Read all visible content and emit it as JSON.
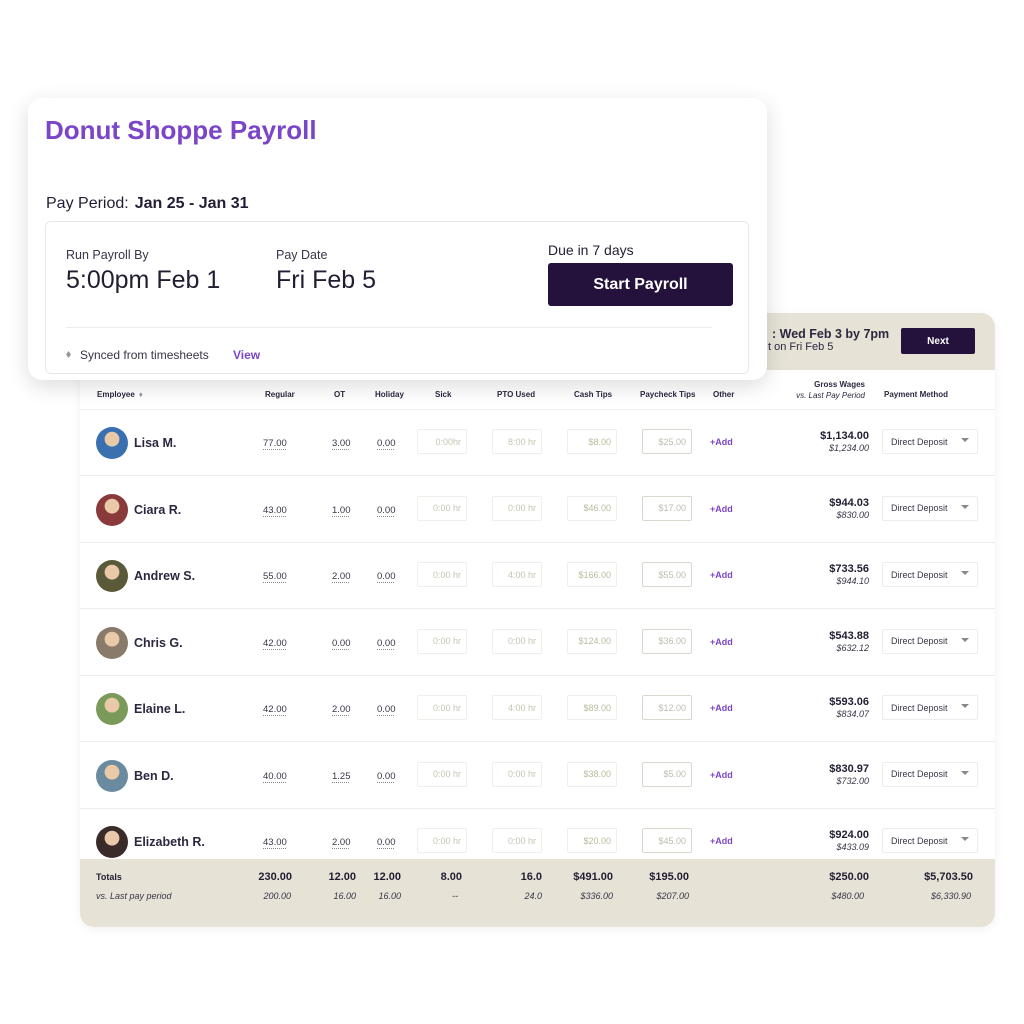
{
  "card": {
    "title": "Donut Shoppe Payroll",
    "pay_period_label": "Pay Period:",
    "pay_period_value": "Jan 25 - Jan 31",
    "run_by_label": "Run Payroll By",
    "run_by_value": "5:00pm Feb 1",
    "pay_date_label": "Pay Date",
    "pay_date_value": "Fri Feb 5",
    "due_text": "Due in 7 days",
    "start_button": "Start Payroll",
    "sync_text": "Synced from timesheets",
    "view_link": "View"
  },
  "table_panel": {
    "due_line1": ": Wed Feb 3 by 7pm",
    "due_line2": "t on Fri Feb 5",
    "next_button": "Next",
    "columns": {
      "employee": "Employee",
      "regular": "Regular",
      "ot": "OT",
      "holiday": "Holiday",
      "sick": "Sick",
      "pto_used": "PTO Used",
      "cash_tips": "Cash Tips",
      "paycheck_tips": "Paycheck Tips",
      "other": "Other",
      "gross_wages": "Gross Wages",
      "gross_wages_sub": "vs. Last Pay Period",
      "payment_method": "Payment Method"
    },
    "sort_icon": "sort-icon",
    "rows": [
      {
        "name": "Lisa M.",
        "regular": "77.00",
        "ot": "3.00",
        "holiday": "0.00",
        "sick": "0:00hr",
        "pto": "8:00 hr",
        "cash_tips": "$8.00",
        "paycheck_tips": "$25.00",
        "other": "+Add",
        "gross": "$1,134.00",
        "gross_prev": "$1,234.00",
        "payment": "Direct Deposit",
        "avatar_color": "#3a6fb0"
      },
      {
        "name": "Ciara R.",
        "regular": "43.00",
        "ot": "1.00",
        "holiday": "0.00",
        "sick": "0:00 hr",
        "pto": "0:00 hr",
        "cash_tips": "$46.00",
        "paycheck_tips": "$17.00",
        "other": "+Add",
        "gross": "$944.03",
        "gross_prev": "$830.00",
        "payment": "Direct Deposit",
        "avatar_color": "#8a3a3a"
      },
      {
        "name": "Andrew S.",
        "regular": "55.00",
        "ot": "2.00",
        "holiday": "0.00",
        "sick": "0:00 hr",
        "pto": "4:00 hr",
        "cash_tips": "$166.00",
        "paycheck_tips": "$55.00",
        "other": "+Add",
        "gross": "$733.56",
        "gross_prev": "$944.10",
        "payment": "Direct Deposit",
        "avatar_color": "#5a5a3a"
      },
      {
        "name": "Chris G.",
        "regular": "42.00",
        "ot": "0.00",
        "holiday": "0.00",
        "sick": "0:00 hr",
        "pto": "0:00 hr",
        "cash_tips": "$124.00",
        "paycheck_tips": "$36.00",
        "other": "+Add",
        "gross": "$543.88",
        "gross_prev": "$632.12",
        "payment": "Direct Deposit",
        "avatar_color": "#8a7a6a"
      },
      {
        "name": "Elaine L.",
        "regular": "42.00",
        "ot": "2.00",
        "holiday": "0.00",
        "sick": "0:00 hr",
        "pto": "4:00 hr",
        "cash_tips": "$89.00",
        "paycheck_tips": "$12.00",
        "other": "+Add",
        "gross": "$593.06",
        "gross_prev": "$834.07",
        "payment": "Direct Deposit",
        "avatar_color": "#7a9a5a"
      },
      {
        "name": "Ben D.",
        "regular": "40.00",
        "ot": "1.25",
        "holiday": "0.00",
        "sick": "0:00 hr",
        "pto": "0:00 hr",
        "cash_tips": "$38.00",
        "paycheck_tips": "$5.00",
        "other": "+Add",
        "gross": "$830.97",
        "gross_prev": "$732.00",
        "payment": "Direct Deposit",
        "avatar_color": "#6a8aa0"
      },
      {
        "name": "Elizabeth R.",
        "regular": "43.00",
        "ot": "2.00",
        "holiday": "0.00",
        "sick": "0:00 hr",
        "pto": "0:00 hr",
        "cash_tips": "$20.00",
        "paycheck_tips": "$45.00",
        "other": "+Add",
        "gross": "$924.00",
        "gross_prev": "$433.09",
        "payment": "Direct Deposit",
        "avatar_color": "#3a2a2a"
      }
    ],
    "totals": {
      "label": "Totals",
      "sub_label": "vs. Last pay period",
      "regular": "230.00",
      "regular_prev": "200.00",
      "ot": "12.00",
      "ot_prev": "16.00",
      "holiday": "12.00",
      "holiday_prev": "16.00",
      "sick": "8.00",
      "sick_prev": "--",
      "pto": "16.0",
      "pto_prev": "24.0",
      "cash_tips": "$491.00",
      "cash_tips_prev": "$336.00",
      "paycheck_tips": "$195.00",
      "paycheck_tips_prev": "$207.00",
      "other": "$250.00",
      "other_prev": "$480.00",
      "gross": "$5,703.50",
      "gross_prev": "$6,330.90"
    }
  },
  "colors": {
    "brand_purple": "#7b45c9",
    "dark_button": "#24123d",
    "beige_bar": "#e6e3d6"
  }
}
